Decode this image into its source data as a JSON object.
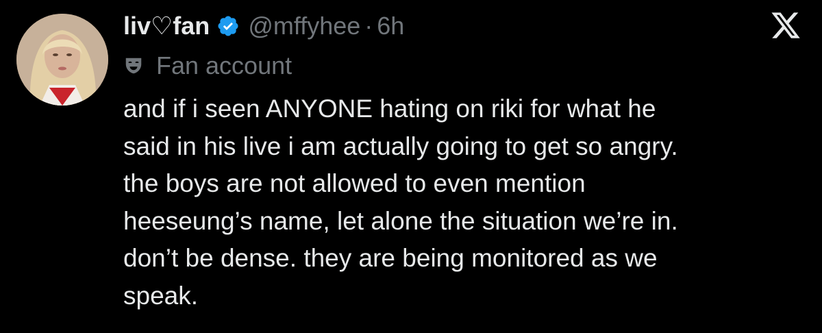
{
  "tweet": {
    "display_name": "liv♡fan",
    "handle": "@mffyhee",
    "separator": "·",
    "time": "6h",
    "label": "Fan account",
    "lines": [
      "and if i seen ANYONE hating on riki for what he",
      "said in his live i am actually going to get so angry.",
      "the boys are not allowed to even mention",
      "heeseung’s name, let alone the situation we’re in.",
      "don’t be dense. they are being monitored as we",
      "speak."
    ]
  },
  "icons": {
    "verified": "verified-badge-icon",
    "label": "theater-mask-icon",
    "brand": "x-logo-icon"
  },
  "colors": {
    "background": "#000000",
    "primary_text": "#e7e9ea",
    "secondary_text": "#71767b",
    "verified_blue": "#1d9bf0"
  }
}
